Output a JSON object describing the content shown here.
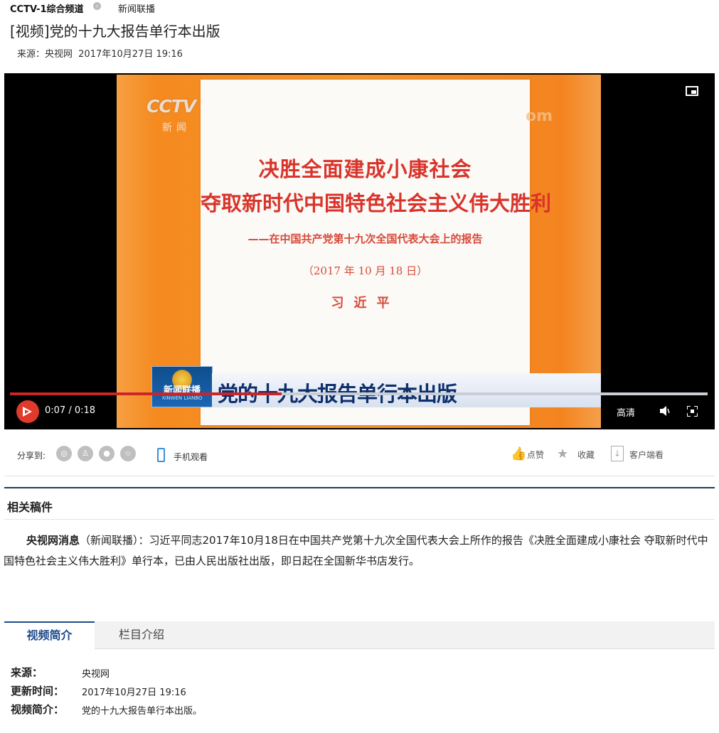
{
  "header": {
    "channel": "CCTV-1综合频道",
    "arrow_glyph": "‹",
    "column": "新闻联播"
  },
  "title": "[视频]党的十九大报告单行本出版",
  "meta": {
    "source": "来源：央视网",
    "datetime": "2017年10月27日 19:16"
  },
  "player": {
    "paper_line1": "决胜全面建成小康社会",
    "paper_line2": "夺取新时代中国特色社会主义伟大胜利",
    "paper_line3": "——在中国共产党第十九次全国代表大会上的报告",
    "paper_line4": "（2017 年 10 月 18 日）",
    "paper_line5": "习近平",
    "logo_text": "CCTV",
    "logo_sub": "新闻",
    "watermark_com": "om",
    "badge_cn": "新闻联播",
    "badge_en": "XINWEN LIANBO",
    "banner_title": "党的十九大报告单行本出版",
    "time_display": "0:07 / 0:18",
    "progress_fraction": 0.389,
    "quality_label": "高清"
  },
  "share": {
    "label": "分享到:",
    "icons": [
      "weibo-icon",
      "qq-icon",
      "wechat-icon",
      "favorite-star-icon"
    ],
    "mobile_label": "手机观看",
    "like_label": "点赞",
    "collect_label": "收藏",
    "client_label": "客户端看"
  },
  "related": {
    "title": "相关稿件",
    "lead": "央视网消息",
    "text": "（新闻联播）：习近平同志2017年10月18日在中国共产党第十九次全国代表大会上所作的报告《决胜全面建成小康社会 夺取新时代中国特色社会主义伟大胜利》单行本，已由人民出版社出版，即日起在全国新华书店发行。"
  },
  "tabs": [
    {
      "label": "视频简介",
      "active": true
    },
    {
      "label": "栏目介绍",
      "active": false
    }
  ],
  "info": {
    "source_key": "来源：",
    "source_val": "央视网",
    "updated_key": "更新时间：",
    "updated_val": "2017年10月27日 19:16",
    "intro_key": "视频简介：",
    "intro_val": "党的十九大报告单行本出版。"
  },
  "colors": {
    "accent_red": "#e03a2d",
    "nav_blue": "#1e4b8c",
    "paper_red": "#d9342b"
  }
}
